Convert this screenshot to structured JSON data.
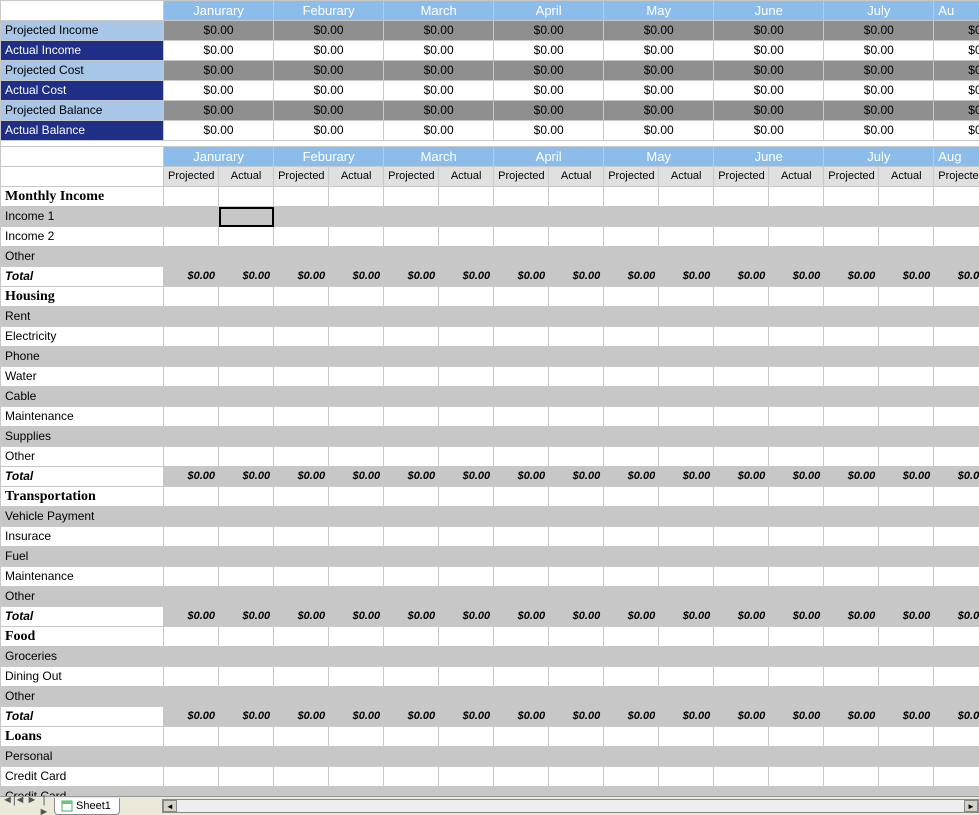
{
  "months": [
    "Janurary",
    "Feburary",
    "March",
    "April",
    "May",
    "June",
    "July"
  ],
  "month_partial": "Au",
  "month_partial2": "Aug",
  "summary": {
    "rows": [
      {
        "label": "Projected Income",
        "style": "light",
        "valStyle": "shade"
      },
      {
        "label": "Actual Income",
        "style": "dark",
        "valStyle": "white"
      },
      {
        "label": "Projected Cost",
        "style": "light",
        "valStyle": "shade"
      },
      {
        "label": "Actual Cost",
        "style": "dark",
        "valStyle": "white"
      },
      {
        "label": "Projected Balance",
        "style": "light",
        "valStyle": "shade"
      },
      {
        "label": "Actual Balance",
        "style": "dark",
        "valStyle": "white"
      }
    ],
    "cell_value": "$0.00",
    "partial_value_shade": "$0.",
    "partial_value_white": "$0."
  },
  "subheaders": {
    "projected": "Projected",
    "actual": "Actual"
  },
  "sections": [
    {
      "title": "Monthly Income",
      "items": [
        "Income 1",
        "Income 2",
        "Other"
      ],
      "total": "Total"
    },
    {
      "title": "Housing",
      "items": [
        "Rent",
        "Electricity",
        "Phone",
        "Water",
        "Cable",
        "Maintenance",
        "Supplies",
        "Other"
      ],
      "total": "Total"
    },
    {
      "title": "Transportation",
      "items": [
        "Vehicle Payment",
        "Insurace",
        "Fuel",
        "Maintenance",
        "Other"
      ],
      "total": "Total"
    },
    {
      "title": "Food",
      "items": [
        "Groceries",
        "Dining Out",
        "Other"
      ],
      "total": "Total"
    },
    {
      "title": "Loans",
      "items": [
        "Personal",
        "Credit Card",
        "Credit Card"
      ],
      "total": null
    }
  ],
  "total_cell": "$0.00",
  "tabs": {
    "sheet": "Sheet1"
  },
  "chart_data": {
    "type": "table",
    "description": "Monthly budget spreadsheet: summary block (projected/actual income,cost,balance) and detail sections (income,housing,transportation,food,loans) with projected vs actual columns per month. All numeric cells are $0.00.",
    "months": [
      "Janurary",
      "Feburary",
      "March",
      "April",
      "May",
      "June",
      "July",
      "August"
    ],
    "summary_rows": [
      "Projected Income",
      "Actual Income",
      "Projected Cost",
      "Actual Cost",
      "Projected Balance",
      "Actual Balance"
    ],
    "summary_values": 0.0,
    "detail_sections": {
      "Monthly Income": [
        "Income 1",
        "Income 2",
        "Other"
      ],
      "Housing": [
        "Rent",
        "Electricity",
        "Phone",
        "Water",
        "Cable",
        "Maintenance",
        "Supplies",
        "Other"
      ],
      "Transportation": [
        "Vehicle Payment",
        "Insurace",
        "Fuel",
        "Maintenance",
        "Other"
      ],
      "Food": [
        "Groceries",
        "Dining Out",
        "Other"
      ],
      "Loans": [
        "Personal",
        "Credit Card",
        "Credit Card"
      ]
    },
    "detail_values": 0.0,
    "totals": 0.0
  }
}
